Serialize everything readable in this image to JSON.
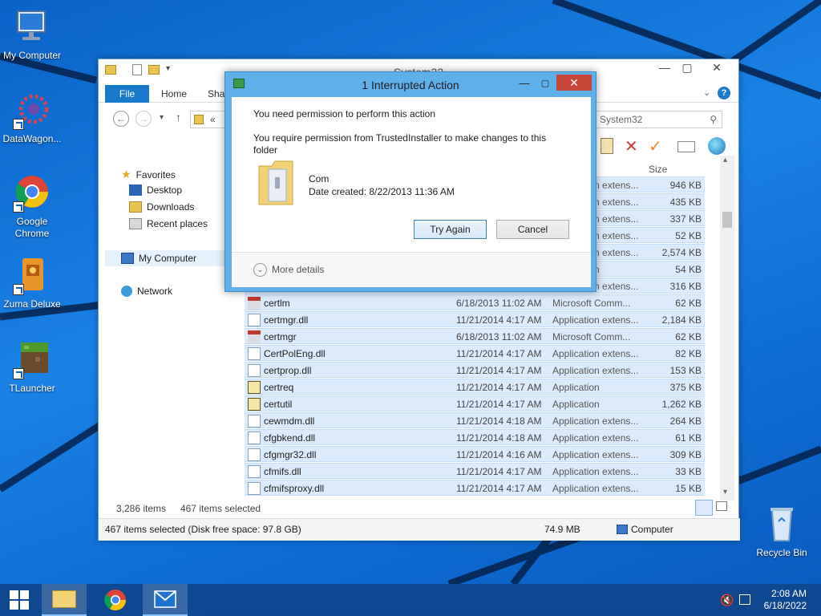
{
  "desktop": {
    "icons": [
      {
        "label": "My Computer"
      },
      {
        "label": "DataWagon..."
      },
      {
        "label": "Google Chrome"
      },
      {
        "label": "Zuma Deluxe"
      },
      {
        "label": "TLauncher"
      },
      {
        "label": "Recycle Bin"
      }
    ]
  },
  "explorer": {
    "title": "System32",
    "tabs": {
      "file": "File",
      "home": "Home",
      "share": "Shar"
    },
    "breadcrumb_prefix": "«",
    "search_placeholder": "System32",
    "nav": {
      "favorites": "Favorites",
      "desktop": "Desktop",
      "downloads": "Downloads",
      "recent": "Recent places",
      "my_computer": "My Computer",
      "network": "Network"
    },
    "columns": {
      "size": "Size"
    },
    "hidden_rows": [
      {
        "type": "Application extens...",
        "size": "946 KB"
      },
      {
        "type": "Application extens...",
        "size": "435 KB"
      },
      {
        "type": "Application extens...",
        "size": "337 KB"
      },
      {
        "type": "Application extens...",
        "size": "52 KB"
      },
      {
        "type": "Application extens...",
        "size": "2,574 KB"
      },
      {
        "type": "Application",
        "size": "54 KB"
      },
      {
        "type": "Application extens...",
        "size": "316 KB"
      }
    ],
    "rows": [
      {
        "name": "certlm",
        "date": "6/18/2013 11:02 AM",
        "type": "Microsoft Comm...",
        "size": "62 KB",
        "icon": "mmc-icon"
      },
      {
        "name": "certmgr.dll",
        "date": "11/21/2014 4:17 AM",
        "type": "Application extens...",
        "size": "2,184 KB",
        "icon": "dll-icon"
      },
      {
        "name": "certmgr",
        "date": "6/18/2013 11:02 AM",
        "type": "Microsoft Comm...",
        "size": "62 KB",
        "icon": "mmc-icon"
      },
      {
        "name": "CertPolEng.dll",
        "date": "11/21/2014 4:17 AM",
        "type": "Application extens...",
        "size": "82 KB",
        "icon": "dll-icon"
      },
      {
        "name": "certprop.dll",
        "date": "11/21/2014 4:17 AM",
        "type": "Application extens...",
        "size": "153 KB",
        "icon": "dll-icon"
      },
      {
        "name": "certreq",
        "date": "11/21/2014 4:17 AM",
        "type": "Application",
        "size": "375 KB",
        "icon": "exe-icon"
      },
      {
        "name": "certutil",
        "date": "11/21/2014 4:17 AM",
        "type": "Application",
        "size": "1,262 KB",
        "icon": "exe-icon"
      },
      {
        "name": "cewmdm.dll",
        "date": "11/21/2014 4:18 AM",
        "type": "Application extens...",
        "size": "264 KB",
        "icon": "dll-icon"
      },
      {
        "name": "cfgbkend.dll",
        "date": "11/21/2014 4:18 AM",
        "type": "Application extens...",
        "size": "61 KB",
        "icon": "dll-icon"
      },
      {
        "name": "cfgmgr32.dll",
        "date": "11/21/2014 4:16 AM",
        "type": "Application extens...",
        "size": "309 KB",
        "icon": "dll-icon"
      },
      {
        "name": "cfmifs.dll",
        "date": "11/21/2014 4:17 AM",
        "type": "Application extens...",
        "size": "33 KB",
        "icon": "dll-icon"
      },
      {
        "name": "cfmifsproxy.dll",
        "date": "11/21/2014 4:17 AM",
        "type": "Application extens...",
        "size": "15 KB",
        "icon": "dll-icon"
      }
    ],
    "status": {
      "items": "3,286 items",
      "selected": "467 items selected",
      "detail": "467 items selected (Disk free space: 97.8 GB)",
      "size": "74.9 MB",
      "location": "Computer"
    }
  },
  "dialog": {
    "title": "1 Interrupted Action",
    "heading": "You need permission to perform this action",
    "message": "You require permission from TrustedInstaller to make changes to this folder",
    "item_name": "Com",
    "item_date": "Date created: 8/22/2013 11:36 AM",
    "try_again": "Try Again",
    "cancel": "Cancel",
    "more_details": "More details"
  },
  "taskbar": {
    "time": "2:08 AM",
    "date": "6/18/2022"
  },
  "colors": {
    "accent": "#1979ca",
    "close_red": "#c7463a",
    "dialog_frame": "#5fb0e8"
  }
}
